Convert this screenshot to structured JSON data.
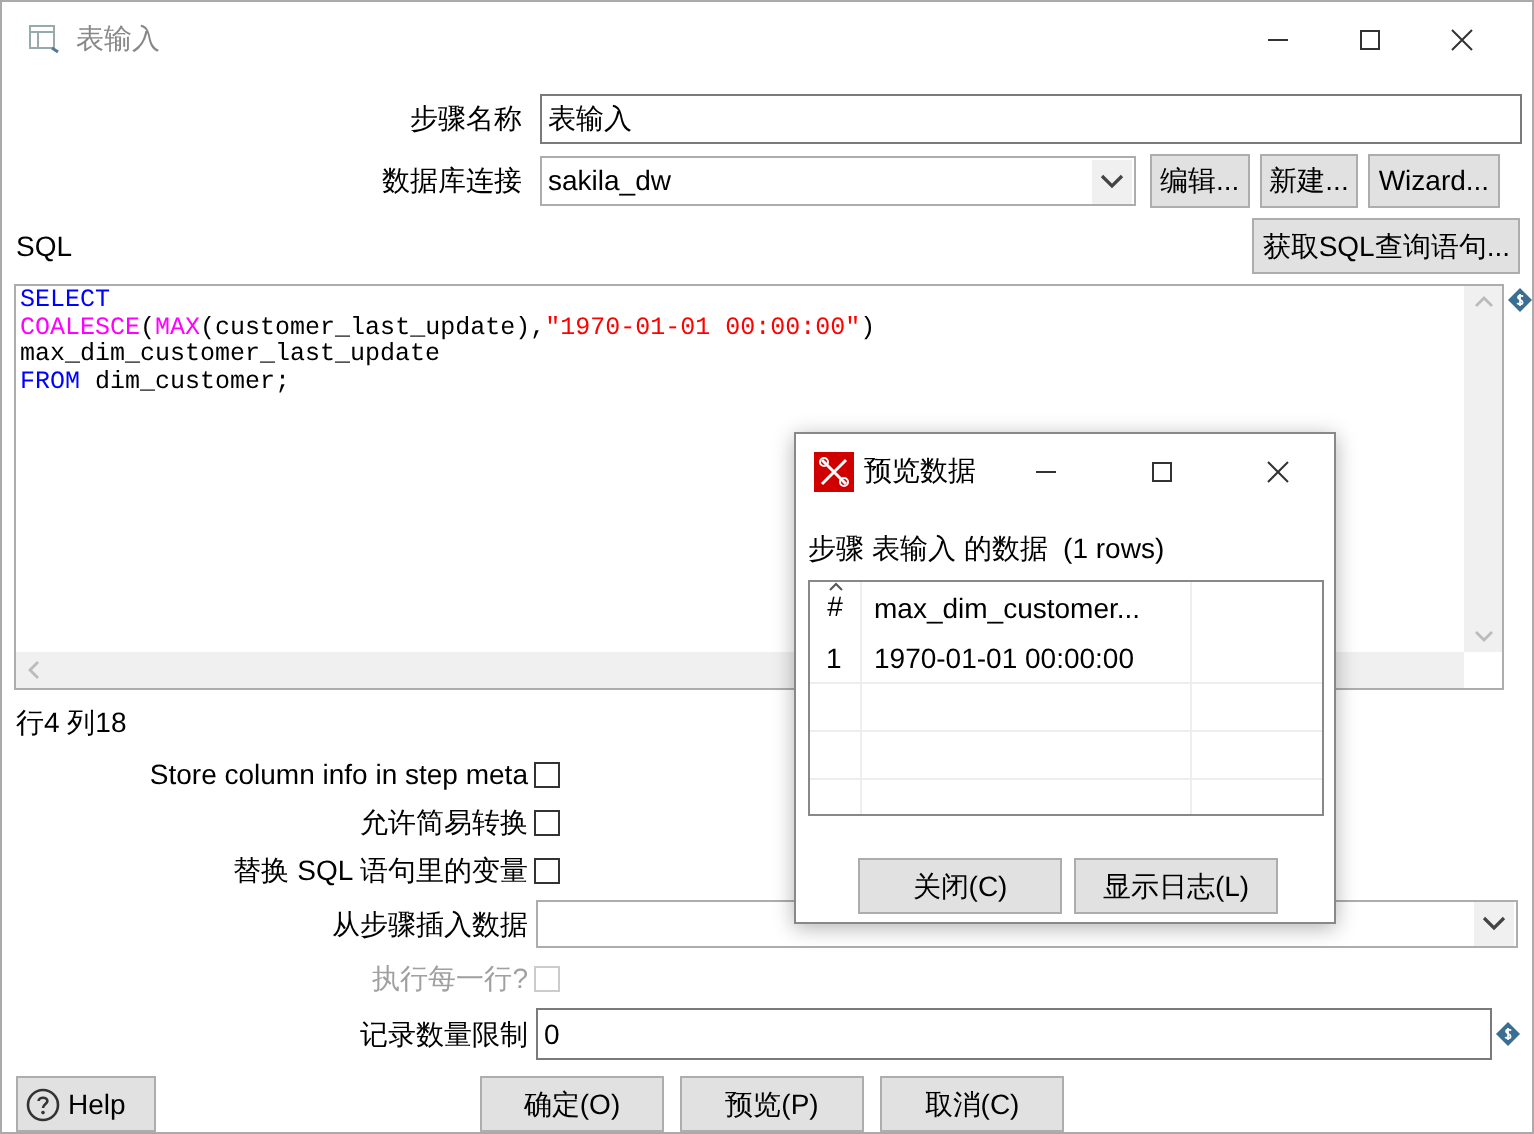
{
  "window": {
    "title": "表输入"
  },
  "step_name": {
    "label": "步骤名称",
    "value": "表输入"
  },
  "connection": {
    "label": "数据库连接",
    "value": "sakila_dw"
  },
  "connection_buttons": [
    "编辑...",
    "新建...",
    "Wizard..."
  ],
  "sql_label": "SQL",
  "get_sql_button": "获取SQL查询语句...",
  "sql_lines": [
    [
      {
        "kind": "keyword",
        "text": "SELECT"
      }
    ],
    [
      {
        "kind": "function",
        "text": "COALESCE"
      },
      {
        "kind": "plain",
        "text": "("
      },
      {
        "kind": "function",
        "text": "MAX"
      },
      {
        "kind": "plain",
        "text": "(customer_last_update),"
      },
      {
        "kind": "string",
        "text": "\"1970-01-01 00:00:00\""
      },
      {
        "kind": "plain",
        "text": ")"
      }
    ],
    [
      {
        "kind": "plain",
        "text": "max_dim_customer_last_update"
      }
    ],
    [
      {
        "kind": "keyword",
        "text": "FROM"
      },
      {
        "kind": "plain",
        "text": " dim_customer;"
      }
    ]
  ],
  "cursor_position": "行4 列18",
  "options": [
    {
      "kind": "checkbox",
      "label": "Store column info in step meta",
      "checked": false,
      "disabled": false
    },
    {
      "kind": "checkbox",
      "label": "允许简易转换",
      "checked": false,
      "disabled": false
    },
    {
      "kind": "checkbox",
      "label": "替换 SQL 语句里的变量",
      "checked": false,
      "disabled": false
    },
    {
      "kind": "dropdown",
      "label": "从步骤插入数据"
    },
    {
      "kind": "checkbox",
      "label": "执行每一行?",
      "checked": false,
      "disabled": true
    },
    {
      "kind": "field",
      "label": "记录数量限制",
      "value": "0"
    }
  ],
  "help_button": "Help",
  "buttons": [
    "确定(O)",
    "预览(P)",
    "取消(C)"
  ],
  "preview_dialog": {
    "title": "预览数据",
    "caption": "步骤 表输入 的数据  (1 rows)",
    "table": {
      "columns": [
        "#",
        "max_dim_customer..."
      ],
      "rows": [
        [
          "1",
          "1970-01-01 00:00:00"
        ]
      ]
    },
    "buttons": [
      "关闭(C)",
      "显示日志(L)"
    ]
  }
}
